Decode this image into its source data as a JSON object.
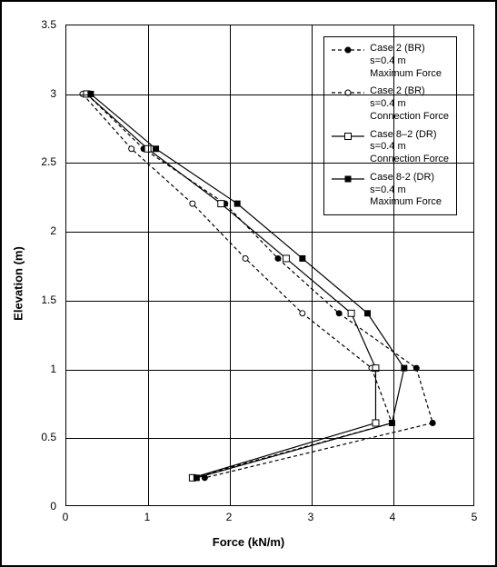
{
  "chart_data": {
    "type": "line",
    "xlabel": "Force (kN/m)",
    "ylabel": "Elevation (m)",
    "xlim": [
      0,
      5
    ],
    "ylim": [
      0,
      3.5
    ],
    "xticks": [
      0,
      1,
      2,
      3,
      4,
      5
    ],
    "yticks": [
      0,
      0.5,
      1,
      1.5,
      2,
      2.5,
      3,
      3.5
    ],
    "series": [
      {
        "name": "Case 2 (BR) s=0.4 m Maximum Force",
        "style": "dashed",
        "marker": "filled-circle",
        "color": "#000000",
        "legend_lines": [
          "Case 2 (BR)",
          "s=0.4 m",
          "Maximum Force"
        ],
        "points": [
          {
            "x": 0.25,
            "y": 3.0
          },
          {
            "x": 0.95,
            "y": 2.6
          },
          {
            "x": 1.95,
            "y": 2.2
          },
          {
            "x": 2.6,
            "y": 1.8
          },
          {
            "x": 3.35,
            "y": 1.4
          },
          {
            "x": 4.3,
            "y": 1.0
          },
          {
            "x": 4.5,
            "y": 0.6
          },
          {
            "x": 1.7,
            "y": 0.2
          }
        ]
      },
      {
        "name": "Case 2 (BR) s=0.4 m Connection Force",
        "style": "dashed",
        "marker": "open-circle",
        "color": "#000000",
        "legend_lines": [
          "Case 2 (BR)",
          "s=0.4 m",
          "Connection Force"
        ],
        "points": [
          {
            "x": 0.2,
            "y": 3.0
          },
          {
            "x": 0.8,
            "y": 2.6
          },
          {
            "x": 1.55,
            "y": 2.2
          },
          {
            "x": 2.2,
            "y": 1.8
          },
          {
            "x": 2.9,
            "y": 1.4
          },
          {
            "x": 3.75,
            "y": 1.0
          },
          {
            "x": 4.0,
            "y": 0.6
          },
          {
            "x": 1.55,
            "y": 0.2
          }
        ]
      },
      {
        "name": "Case 8-2 (DR) s=0.4 m Connection Force",
        "style": "solid",
        "marker": "open-square",
        "color": "#000000",
        "legend_lines": [
          "Case 8–2 (DR)",
          "s=0.4 m",
          "Connection Force"
        ],
        "points": [
          {
            "x": 0.25,
            "y": 3.0
          },
          {
            "x": 1.0,
            "y": 2.6
          },
          {
            "x": 1.9,
            "y": 2.2
          },
          {
            "x": 2.7,
            "y": 1.8
          },
          {
            "x": 3.5,
            "y": 1.4
          },
          {
            "x": 3.8,
            "y": 1.0
          },
          {
            "x": 3.8,
            "y": 0.6
          },
          {
            "x": 1.55,
            "y": 0.2
          }
        ]
      },
      {
        "name": "Case 8-2 (DR) s=0.4 m Maximum Force",
        "style": "solid",
        "marker": "filled-square",
        "color": "#000000",
        "legend_lines": [
          "Case 8-2 (DR)",
          "s=0.4 m",
          "Maximum Force"
        ],
        "points": [
          {
            "x": 0.3,
            "y": 3.0
          },
          {
            "x": 1.1,
            "y": 2.6
          },
          {
            "x": 2.1,
            "y": 2.2
          },
          {
            "x": 2.9,
            "y": 1.8
          },
          {
            "x": 3.7,
            "y": 1.4
          },
          {
            "x": 4.15,
            "y": 1.0
          },
          {
            "x": 4.0,
            "y": 0.6
          },
          {
            "x": 1.6,
            "y": 0.2
          }
        ]
      }
    ]
  }
}
